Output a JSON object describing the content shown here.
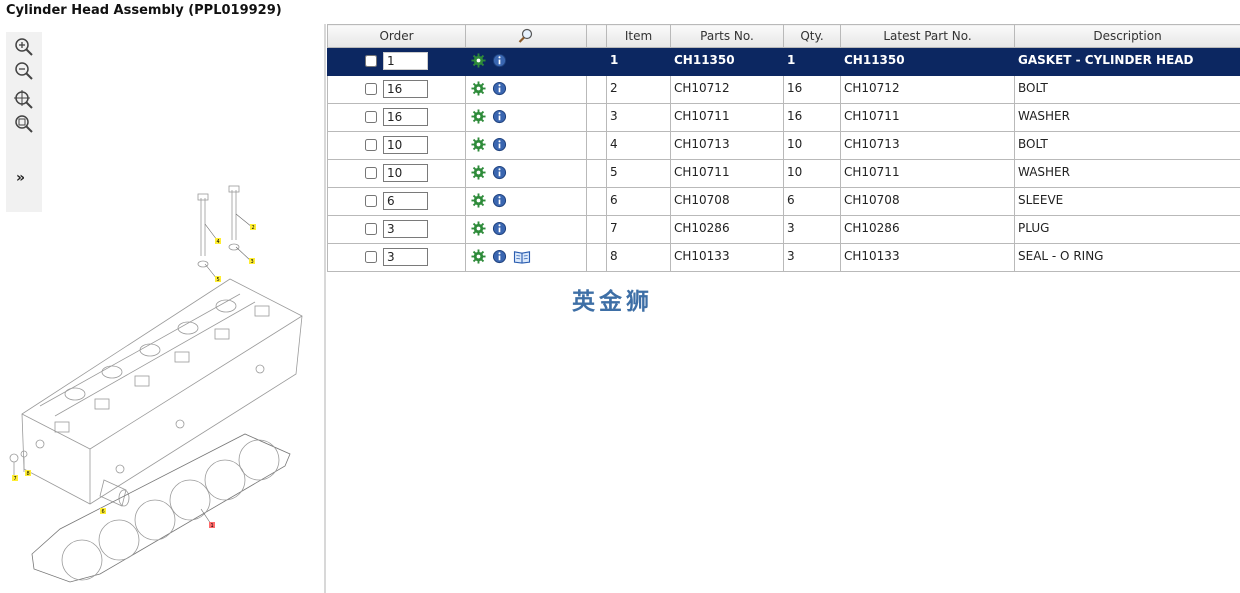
{
  "page": {
    "title": "Cylinder Head Assembly (PPL019929)"
  },
  "toolbar": {
    "zoom_in_icon": "zoom-in-icon",
    "zoom_out_icon": "zoom-out-icon",
    "zoom_fit_icon": "zoom-fit-icon",
    "zoom_area_icon": "zoom-area-icon",
    "expand_label": "»"
  },
  "drawing": {
    "callouts": [
      "1",
      "2",
      "3",
      "4",
      "5",
      "6",
      "7",
      "8"
    ]
  },
  "table": {
    "headers": {
      "order": "Order",
      "search_icon": "magnifier-icon",
      "item": "Item",
      "parts_no": "Parts No.",
      "qty": "Qty.",
      "latest_part_no": "Latest Part No.",
      "description": "Description"
    },
    "rows": [
      {
        "order_qty": "1",
        "item": "1",
        "parts_no": "CH11350",
        "qty": "1",
        "latest_part_no": "CH11350",
        "description": "GASKET - CYLINDER HEAD",
        "selected": true,
        "has_book": false
      },
      {
        "order_qty": "16",
        "item": "2",
        "parts_no": "CH10712",
        "qty": "16",
        "latest_part_no": "CH10712",
        "description": "BOLT",
        "selected": false,
        "has_book": false
      },
      {
        "order_qty": "16",
        "item": "3",
        "parts_no": "CH10711",
        "qty": "16",
        "latest_part_no": "CH10711",
        "description": "WASHER",
        "selected": false,
        "has_book": false
      },
      {
        "order_qty": "10",
        "item": "4",
        "parts_no": "CH10713",
        "qty": "10",
        "latest_part_no": "CH10713",
        "description": "BOLT",
        "selected": false,
        "has_book": false
      },
      {
        "order_qty": "10",
        "item": "5",
        "parts_no": "CH10711",
        "qty": "10",
        "latest_part_no": "CH10711",
        "description": "WASHER",
        "selected": false,
        "has_book": false
      },
      {
        "order_qty": "6",
        "item": "6",
        "parts_no": "CH10708",
        "qty": "6",
        "latest_part_no": "CH10708",
        "description": "SLEEVE",
        "selected": false,
        "has_book": false
      },
      {
        "order_qty": "3",
        "item": "7",
        "parts_no": "CH10286",
        "qty": "3",
        "latest_part_no": "CH10286",
        "description": "PLUG",
        "selected": false,
        "has_book": false
      },
      {
        "order_qty": "3",
        "item": "8",
        "parts_no": "CH10133",
        "qty": "3",
        "latest_part_no": "CH10133",
        "description": "SEAL - O RING",
        "selected": false,
        "has_book": true
      }
    ]
  },
  "watermark": {
    "text": "英金狮"
  },
  "colors": {
    "selected_row": "#0c2761",
    "gear_icon": "#2e8b3a",
    "info_icon": "#3a66b0",
    "watermark": "#3e6fa6"
  }
}
